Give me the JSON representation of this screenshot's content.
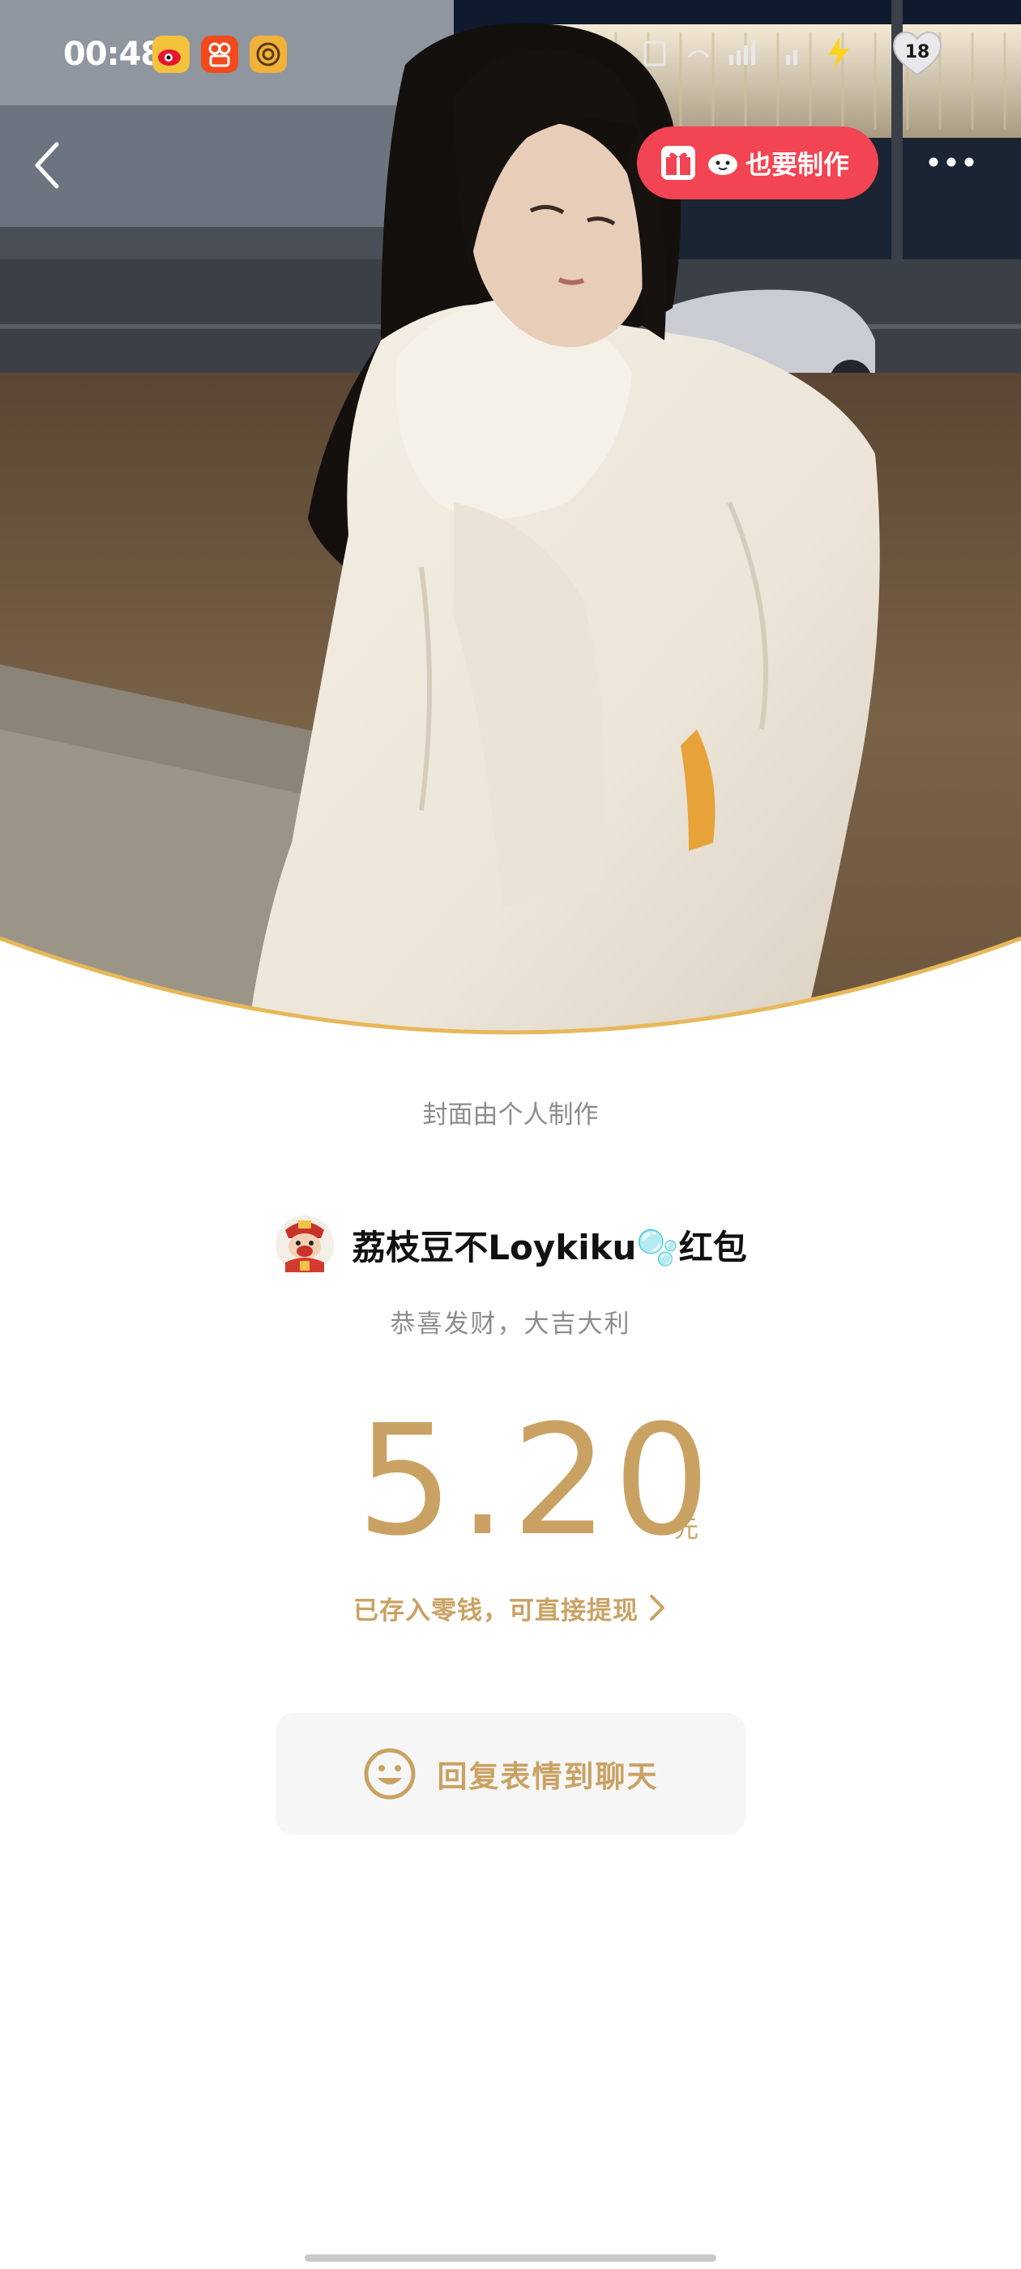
{
  "status_bar": {
    "time": "00:48",
    "apps": [
      "weibo-icon",
      "kuaishou-icon",
      "camera-app-icon"
    ],
    "battery_level": "18"
  },
  "toolbar": {
    "back_icon": "chevron-left-icon",
    "make_button_label": "也要制作",
    "more_icon": "more-dots-icon"
  },
  "cover": {
    "note": "封面由个人制作"
  },
  "red_packet": {
    "sender": "荔枝豆不Loykiku🫧红包",
    "blessing": "恭喜发财，大吉大利",
    "amount": "5.20",
    "unit": "元",
    "stored_text": "已存入零钱，可直接提现"
  },
  "reply": {
    "label": "回复表情到聊天"
  },
  "colors": {
    "gold": "#c9a263",
    "red_button": "#f24452",
    "gray_text": "#8c8c8c"
  }
}
